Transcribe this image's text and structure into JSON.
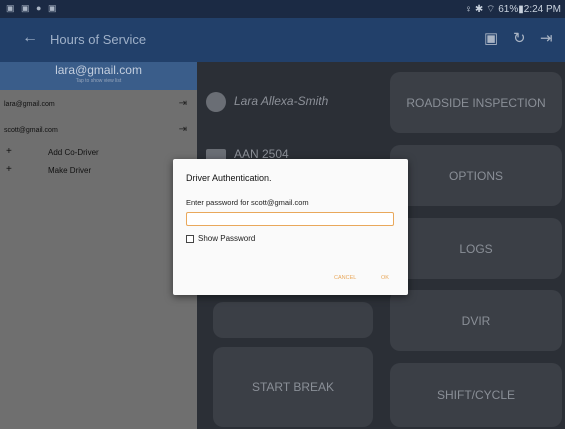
{
  "statusbar": {
    "left_icons": "▣ ▣ ● ▣",
    "right": "♀ ✱ ⌔ 61%▮2:24 PM"
  },
  "appbar": {
    "title": "Hours of Service",
    "back_icon": "back-arrow-icon",
    "icons": [
      "sync-icon",
      "refresh-icon",
      "logout-icon"
    ]
  },
  "drawer": {
    "header_email": "lara@gmail.com",
    "header_hint": "Tap to show view list",
    "users": [
      {
        "email": "lara@gmail.com"
      },
      {
        "email": "scott@gmail.com"
      }
    ],
    "actions": [
      {
        "label": "Add Co-Driver"
      },
      {
        "label": "Make Driver"
      }
    ]
  },
  "main": {
    "driver_name": "Lara Allexa-Smith",
    "unit": "AAN 2504",
    "tiles": [
      "ROADSIDE INSPECTION",
      "OPTIONS",
      "LOGS",
      "DVIR",
      "START BREAK",
      "SHIFT/CYCLE"
    ]
  },
  "dialog": {
    "title": "Driver Authentication.",
    "prompt": "Enter password for scott@gmail.com",
    "password_value": "",
    "show_password_label": "Show Password",
    "show_password_checked": false,
    "cancel_label": "CANCEL",
    "ok_label": "OK"
  },
  "colors": {
    "appbar": "#22406a",
    "accent": "#e9a85b",
    "drawer_header": "#3a5d8a"
  }
}
